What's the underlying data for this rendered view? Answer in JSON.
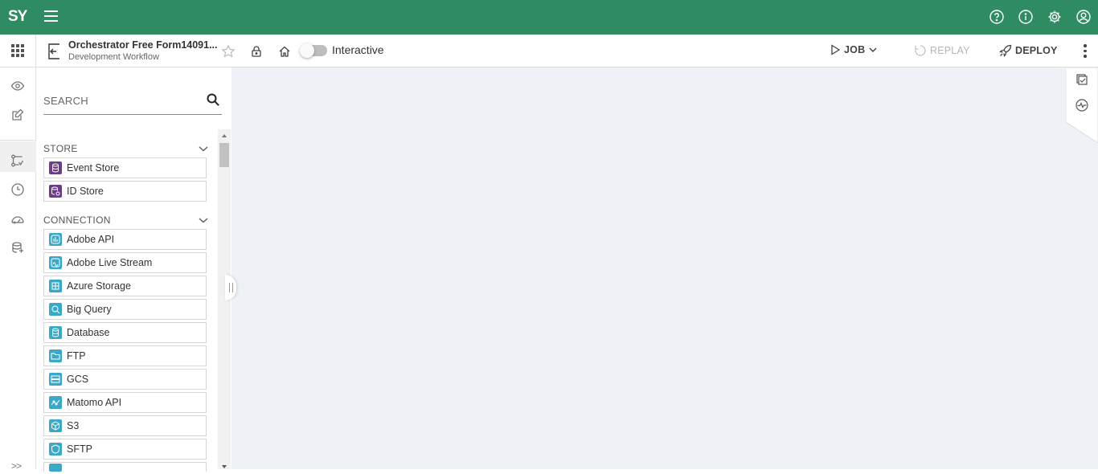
{
  "topbar": {
    "logo": "SY",
    "icons": [
      "help-icon",
      "info-icon",
      "gear-icon",
      "account-icon"
    ],
    "color": "#2e8b62"
  },
  "rail": {
    "icons": [
      "eye-icon",
      "edit-icon",
      "workflow-icon",
      "clock-icon",
      "dashboard-icon",
      "database-stack-icon"
    ],
    "expand_label": ">>"
  },
  "header": {
    "title": "Orchestrator Free Form14091...",
    "subtitle": "Development Workflow",
    "toggle_label": "Interactive",
    "job_label": "JOB",
    "replay_label": "REPLAY",
    "deploy_label": "DEPLOY"
  },
  "palette": {
    "search_placeholder": "SEARCH",
    "sections": [
      {
        "title": "STORE",
        "items": [
          {
            "label": "Event Store",
            "color": "#6d3c87"
          },
          {
            "label": "ID Store",
            "color": "#6d3c87"
          }
        ]
      },
      {
        "title": "CONNECTION",
        "items": [
          {
            "label": "Adobe API",
            "color": "#3aa8c6"
          },
          {
            "label": "Adobe Live Stream",
            "color": "#3aa8c6"
          },
          {
            "label": "Azure Storage",
            "color": "#3aa8c6"
          },
          {
            "label": "Big Query",
            "color": "#3aa8c6"
          },
          {
            "label": "Database",
            "color": "#3aa8c6"
          },
          {
            "label": "FTP",
            "color": "#3aa8c6"
          },
          {
            "label": "GCS",
            "color": "#3aa8c6"
          },
          {
            "label": "Matomo API",
            "color": "#3aa8c6"
          },
          {
            "label": "S3",
            "color": "#3aa8c6"
          },
          {
            "label": "SFTP",
            "color": "#3aa8c6"
          }
        ]
      }
    ]
  },
  "canvas": {
    "background": "#eef2f6",
    "right_icons": [
      "checklist-icon",
      "activity-icon"
    ]
  }
}
